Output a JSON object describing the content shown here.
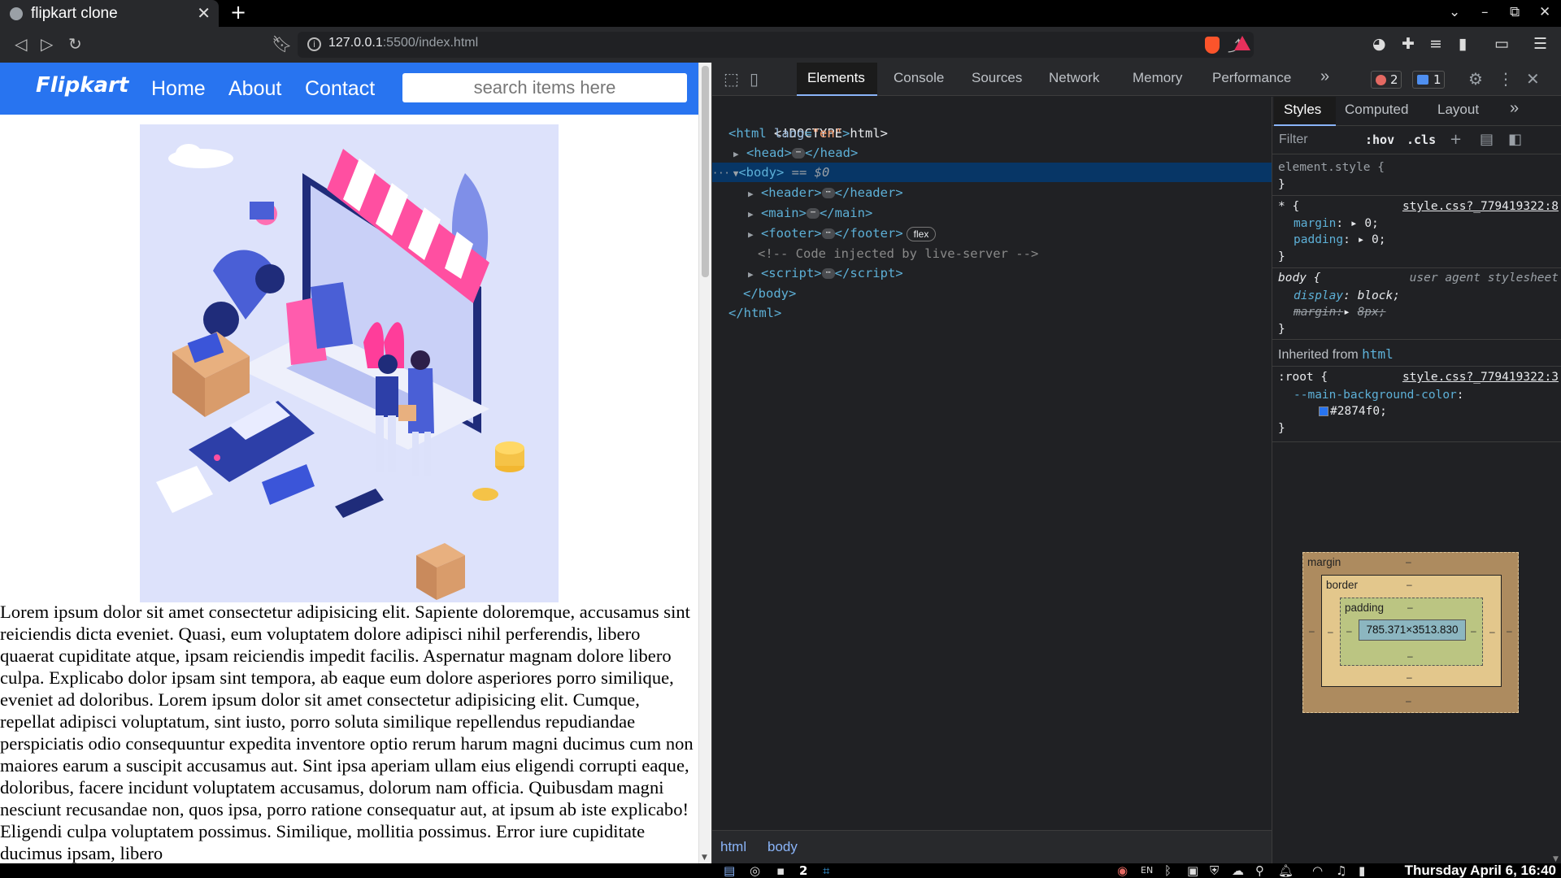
{
  "browser": {
    "tab_title": "flipkart clone",
    "new_tab": "+",
    "url_host": "127.0.0.1",
    "url_path": ":5500/index.html"
  },
  "site": {
    "logo": "Flipkart",
    "nav": [
      "Home",
      "About",
      "Contact"
    ],
    "search_placeholder": "search items here",
    "paragraph": "Lorem ipsum dolor sit amet consectetur adipisicing elit. Sapiente doloremque, accusamus sint reiciendis dicta eveniet. Quasi, eum voluptatem dolore adipisci nihil perferendis, libero quaerat cupiditate atque, ipsam reiciendis impedit facilis. Aspernatur magnam dolore libero culpa. Explicabo dolor ipsam sint tempora, ab eaque eum dolore asperiores porro similique, eveniet ad doloribus. Lorem ipsum dolor sit amet consectetur adipisicing elit. Cumque, repellat adipisci voluptatum, sint iusto, porro soluta similique repellendus repudiandae perspiciatis odio consequuntur expedita inventore optio rerum harum magni ducimus cum non maiores earum a suscipit accusamus aut. Sint ipsa aperiam ullam eius eligendi corrupti eaque, doloribus, facere incidunt voluptatem accusamus, dolorum nam officia. Quibusdam magni nesciunt recusandae non, quos ipsa, porro ratione consequatur aut, at ipsum ab iste explicabo! Eligendi culpa voluptatem possimus. Similique, mollitia possimus. Error iure cupiditate ducimus ipsam, libero"
  },
  "devtools": {
    "tabs": [
      "Elements",
      "Console",
      "Sources",
      "Network",
      "Memory",
      "Performance"
    ],
    "more": "»",
    "errors": "2",
    "messages": "1",
    "breadcrumbs": [
      "html",
      "body"
    ],
    "dom": {
      "doctype": "<!DOCTYPE html>",
      "html_open_tag": "<html",
      "html_attr": "lang",
      "html_attr_value": "\"en\"",
      "head": "head",
      "body": "body",
      "eq0": "== $0",
      "header": "header",
      "main": "main",
      "footer": "footer",
      "flex_badge": "flex",
      "comment": "<!-- Code injected by live-server -->",
      "script": "script",
      "body_close": "</body>",
      "html_close": "</html>"
    },
    "styles": {
      "tabs": [
        "Styles",
        "Computed",
        "Layout"
      ],
      "filter": "Filter",
      "hov": ":hov",
      "cls": ".cls",
      "element_style": "element.style {",
      "close_brace": "}",
      "star_selector": "* {",
      "star_source": "style.css?_779419322:8",
      "margin_prop": "margin",
      "margin_val": "0;",
      "padding_prop": "padding",
      "padding_val": "0;",
      "body_selector": "body {",
      "ua_label": "user agent stylesheet",
      "display_prop": "display",
      "display_val": "block;",
      "ua_margin": "margin:",
      "ua_margin_val": "8px;",
      "inherited_label": "Inherited from",
      "inherited_tag": "html",
      "root_selector": ":root {",
      "root_source": "style.css?_779419322:3",
      "var_name": "--main-background-color",
      "var_value": "#2874f0;",
      "accent_color": "#2874f0"
    },
    "box_model": {
      "margin": "margin",
      "border": "border",
      "padding": "padding",
      "content": "785.371×3513.830",
      "dash": "–"
    }
  },
  "taskbar": {
    "workspace": "2",
    "lang": "EN",
    "clock": "Thursday April  6, 16:40"
  }
}
